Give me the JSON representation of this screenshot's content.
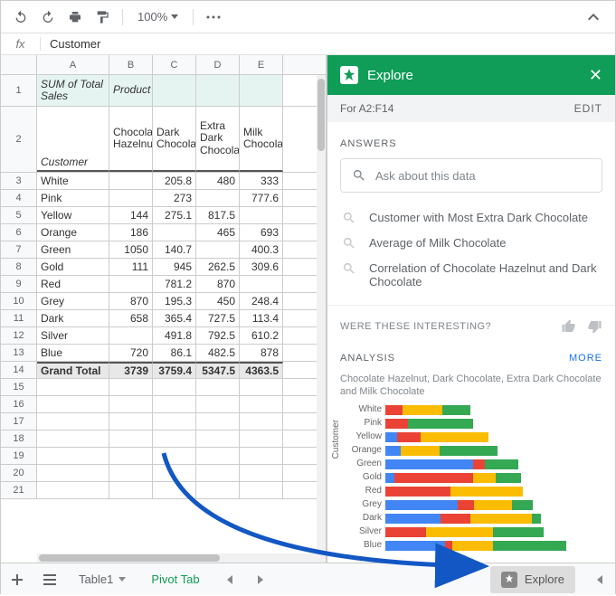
{
  "toolbar": {
    "zoom": "100%"
  },
  "formula": {
    "label": "fx",
    "value": "Customer"
  },
  "columns": [
    "A",
    "B",
    "C",
    "D",
    "E"
  ],
  "pivot": {
    "sum_label": "SUM of Total Sales",
    "col_field": "Product",
    "row_field": "Customer",
    "col_headers": [
      "Chocolate Hazelnut",
      "Dark Chocolate",
      "Extra Dark Chocolate",
      "Milk Chocolate"
    ],
    "rows": [
      {
        "k": "White",
        "v": [
          "",
          "205.8",
          "480",
          "333"
        ]
      },
      {
        "k": "Pink",
        "v": [
          "",
          "273",
          "",
          "777.6"
        ]
      },
      {
        "k": "Yellow",
        "v": [
          "144",
          "275.1",
          "817.5",
          ""
        ]
      },
      {
        "k": "Orange",
        "v": [
          "186",
          "",
          "465",
          "693"
        ]
      },
      {
        "k": "Green",
        "v": [
          "1050",
          "140.7",
          "",
          "400.3"
        ]
      },
      {
        "k": "Gold",
        "v": [
          "111",
          "945",
          "262.5",
          "309.6"
        ]
      },
      {
        "k": "Red",
        "v": [
          "",
          "781.2",
          "870",
          ""
        ]
      },
      {
        "k": "Grey",
        "v": [
          "870",
          "195.3",
          "450",
          "248.4"
        ]
      },
      {
        "k": "Dark",
        "v": [
          "658",
          "365.4",
          "727.5",
          "113.4"
        ]
      },
      {
        "k": "Silver",
        "v": [
          "",
          "491.8",
          "792.5",
          "610.2"
        ]
      },
      {
        "k": "Blue",
        "v": [
          "720",
          "86.1",
          "482.5",
          "878"
        ]
      }
    ],
    "grand_total": {
      "k": "Grand Total",
      "v": [
        "3739",
        "3759.4",
        "5347.5",
        "4363.5"
      ]
    }
  },
  "explore": {
    "title": "Explore",
    "range": "For A2:F14",
    "edit": "EDIT",
    "answers": "ANSWERS",
    "ask_placeholder": "Ask about this data",
    "suggestions": [
      "Customer with Most Extra Dark Chocolate",
      "Average of Milk Chocolate",
      "Correlation of Chocolate Hazelnut and Dark Chocolate"
    ],
    "interesting": "WERE THESE INTERESTING?",
    "analysis": "ANALYSIS",
    "more": "MORE",
    "chart_title": "Chocolate Hazelnut, Dark Chocolate, Extra Dark Chocolate and Milk Chocolate",
    "chart_ylabel": "Customer"
  },
  "chart_data": {
    "type": "bar",
    "orientation": "horizontal",
    "stacked": true,
    "ylabel": "Customer",
    "title": "Chocolate Hazelnut, Dark Chocolate, Extra Dark Chocolate and Milk Chocolate",
    "categories": [
      "White",
      "Pink",
      "Yellow",
      "Orange",
      "Green",
      "Gold",
      "Red",
      "Grey",
      "Dark",
      "Silver",
      "Blue"
    ],
    "series": [
      {
        "name": "Chocolate Hazelnut",
        "color": "#4285f4",
        "values": [
          0,
          0,
          144,
          186,
          1050,
          111,
          0,
          870,
          658,
          0,
          720
        ]
      },
      {
        "name": "Dark Chocolate",
        "color": "#ea4335",
        "values": [
          205.8,
          273,
          275.1,
          0,
          140.7,
          945,
          781.2,
          195.3,
          365.4,
          491.8,
          86.1
        ]
      },
      {
        "name": "Extra Dark Chocolate",
        "color": "#fbbc04",
        "values": [
          480,
          0,
          817.5,
          465,
          0,
          262.5,
          870,
          450,
          727.5,
          792.5,
          482.5
        ]
      },
      {
        "name": "Milk Chocolate",
        "color": "#34a853",
        "values": [
          333,
          777.6,
          0,
          693,
          400.3,
          309.6,
          0,
          248.4,
          113.4,
          610.2,
          878
        ]
      }
    ]
  },
  "tabs": {
    "t1": "Table1",
    "t2": "Pivot Tab",
    "explore_btn": "Explore"
  }
}
